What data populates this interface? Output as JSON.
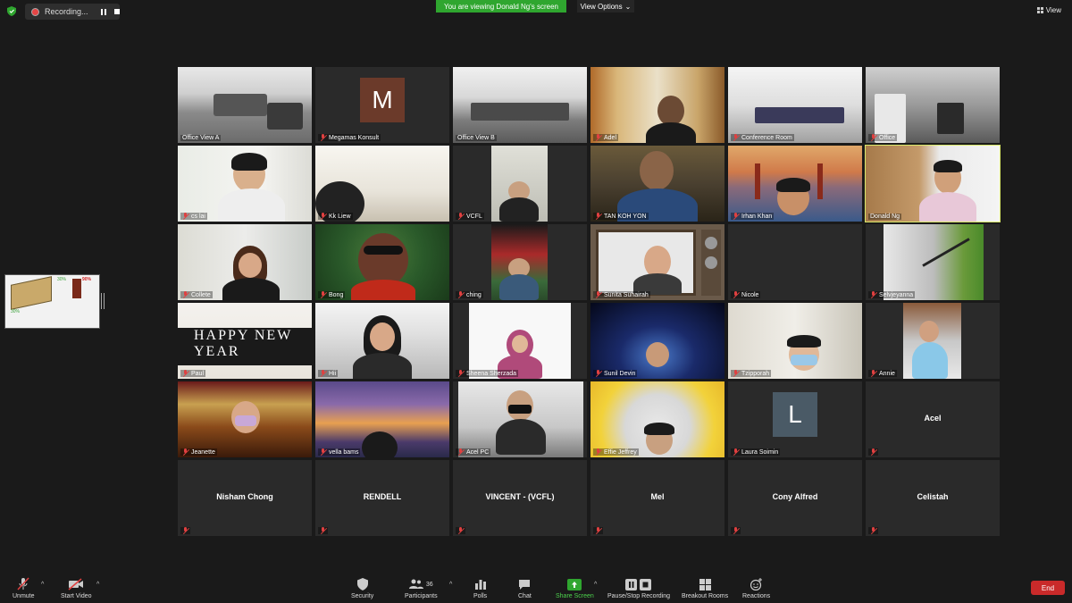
{
  "topbar": {
    "recording": "Recording...",
    "viewing_banner": "You are viewing Donald Ng's screen",
    "view_options": "View Options",
    "view": "View"
  },
  "share_thumb": {
    "label1": "30%",
    "label2": "90%",
    "label3": "30%"
  },
  "tiles": [
    {
      "name": "Office View A"
    },
    {
      "name": "Megamas Konsult",
      "initial": "M"
    },
    {
      "name": "Office View B"
    },
    {
      "name": "Adel"
    },
    {
      "name": "Conference Room"
    },
    {
      "name": "Office"
    },
    {
      "name": "cs lai"
    },
    {
      "name": "Kk Liew"
    },
    {
      "name": "VCFL"
    },
    {
      "name": "TAN KOH YON"
    },
    {
      "name": "Irhan Khan"
    },
    {
      "name": "Donald Ng"
    },
    {
      "name": "Collete"
    },
    {
      "name": "Bong"
    },
    {
      "name": "ching"
    },
    {
      "name": "Sunita Suhairah"
    },
    {
      "name": "Nicole"
    },
    {
      "name": "Selvjeyanna"
    },
    {
      "name": "Paul",
      "sign": "HAPPY NEW YEAR"
    },
    {
      "name": "Hii"
    },
    {
      "name": "Sheena Sherzada"
    },
    {
      "name": "Sunil Devin"
    },
    {
      "name": "Tzipporah"
    },
    {
      "name": "Annie"
    },
    {
      "name": "Jeanette"
    },
    {
      "name": "vella bams"
    },
    {
      "name": "Acel PC"
    },
    {
      "name": "Effie Jeffrey"
    },
    {
      "name": "Laura Soimin",
      "initial": "L"
    },
    {
      "name": "Acel"
    },
    {
      "name": "Nisham Chong"
    },
    {
      "name": "RENDELL"
    },
    {
      "name": "VINCENT - (VCFL)"
    },
    {
      "name": "Mel"
    },
    {
      "name": "Cony Alfred"
    },
    {
      "name": "Celistah"
    }
  ],
  "toolbar": {
    "unmute": "Unmute",
    "start_video": "Start Video",
    "security": "Security",
    "participants": "Participants",
    "participants_count": "36",
    "polls": "Polls",
    "chat": "Chat",
    "share_screen": "Share Screen",
    "pause_recording": "Pause/Stop Recording",
    "breakout_rooms": "Breakout Rooms",
    "reactions": "Reactions",
    "end": "End"
  },
  "colors": {
    "accent_green": "#2fa62f",
    "end_red": "#c92a2a",
    "active_speaker": "#d9e86a"
  }
}
